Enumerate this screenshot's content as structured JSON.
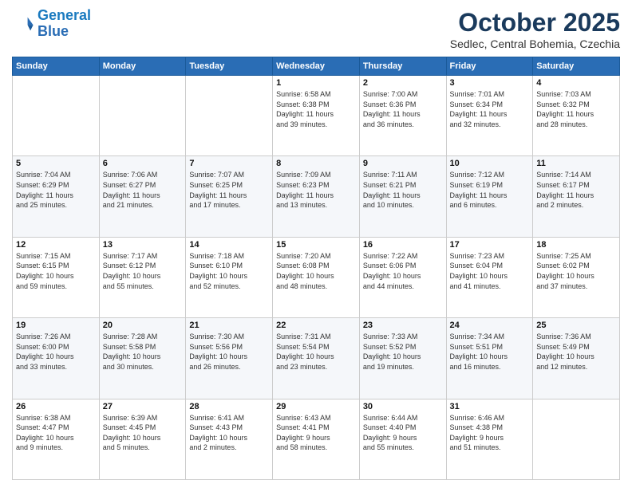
{
  "logo": {
    "line1": "General",
    "line2": "Blue"
  },
  "header": {
    "month": "October 2025",
    "location": "Sedlec, Central Bohemia, Czechia"
  },
  "days_of_week": [
    "Sunday",
    "Monday",
    "Tuesday",
    "Wednesday",
    "Thursday",
    "Friday",
    "Saturday"
  ],
  "weeks": [
    [
      {
        "day": "",
        "info": ""
      },
      {
        "day": "",
        "info": ""
      },
      {
        "day": "",
        "info": ""
      },
      {
        "day": "1",
        "info": "Sunrise: 6:58 AM\nSunset: 6:38 PM\nDaylight: 11 hours\nand 39 minutes."
      },
      {
        "day": "2",
        "info": "Sunrise: 7:00 AM\nSunset: 6:36 PM\nDaylight: 11 hours\nand 36 minutes."
      },
      {
        "day": "3",
        "info": "Sunrise: 7:01 AM\nSunset: 6:34 PM\nDaylight: 11 hours\nand 32 minutes."
      },
      {
        "day": "4",
        "info": "Sunrise: 7:03 AM\nSunset: 6:32 PM\nDaylight: 11 hours\nand 28 minutes."
      }
    ],
    [
      {
        "day": "5",
        "info": "Sunrise: 7:04 AM\nSunset: 6:29 PM\nDaylight: 11 hours\nand 25 minutes."
      },
      {
        "day": "6",
        "info": "Sunrise: 7:06 AM\nSunset: 6:27 PM\nDaylight: 11 hours\nand 21 minutes."
      },
      {
        "day": "7",
        "info": "Sunrise: 7:07 AM\nSunset: 6:25 PM\nDaylight: 11 hours\nand 17 minutes."
      },
      {
        "day": "8",
        "info": "Sunrise: 7:09 AM\nSunset: 6:23 PM\nDaylight: 11 hours\nand 13 minutes."
      },
      {
        "day": "9",
        "info": "Sunrise: 7:11 AM\nSunset: 6:21 PM\nDaylight: 11 hours\nand 10 minutes."
      },
      {
        "day": "10",
        "info": "Sunrise: 7:12 AM\nSunset: 6:19 PM\nDaylight: 11 hours\nand 6 minutes."
      },
      {
        "day": "11",
        "info": "Sunrise: 7:14 AM\nSunset: 6:17 PM\nDaylight: 11 hours\nand 2 minutes."
      }
    ],
    [
      {
        "day": "12",
        "info": "Sunrise: 7:15 AM\nSunset: 6:15 PM\nDaylight: 10 hours\nand 59 minutes."
      },
      {
        "day": "13",
        "info": "Sunrise: 7:17 AM\nSunset: 6:12 PM\nDaylight: 10 hours\nand 55 minutes."
      },
      {
        "day": "14",
        "info": "Sunrise: 7:18 AM\nSunset: 6:10 PM\nDaylight: 10 hours\nand 52 minutes."
      },
      {
        "day": "15",
        "info": "Sunrise: 7:20 AM\nSunset: 6:08 PM\nDaylight: 10 hours\nand 48 minutes."
      },
      {
        "day": "16",
        "info": "Sunrise: 7:22 AM\nSunset: 6:06 PM\nDaylight: 10 hours\nand 44 minutes."
      },
      {
        "day": "17",
        "info": "Sunrise: 7:23 AM\nSunset: 6:04 PM\nDaylight: 10 hours\nand 41 minutes."
      },
      {
        "day": "18",
        "info": "Sunrise: 7:25 AM\nSunset: 6:02 PM\nDaylight: 10 hours\nand 37 minutes."
      }
    ],
    [
      {
        "day": "19",
        "info": "Sunrise: 7:26 AM\nSunset: 6:00 PM\nDaylight: 10 hours\nand 33 minutes."
      },
      {
        "day": "20",
        "info": "Sunrise: 7:28 AM\nSunset: 5:58 PM\nDaylight: 10 hours\nand 30 minutes."
      },
      {
        "day": "21",
        "info": "Sunrise: 7:30 AM\nSunset: 5:56 PM\nDaylight: 10 hours\nand 26 minutes."
      },
      {
        "day": "22",
        "info": "Sunrise: 7:31 AM\nSunset: 5:54 PM\nDaylight: 10 hours\nand 23 minutes."
      },
      {
        "day": "23",
        "info": "Sunrise: 7:33 AM\nSunset: 5:52 PM\nDaylight: 10 hours\nand 19 minutes."
      },
      {
        "day": "24",
        "info": "Sunrise: 7:34 AM\nSunset: 5:51 PM\nDaylight: 10 hours\nand 16 minutes."
      },
      {
        "day": "25",
        "info": "Sunrise: 7:36 AM\nSunset: 5:49 PM\nDaylight: 10 hours\nand 12 minutes."
      }
    ],
    [
      {
        "day": "26",
        "info": "Sunrise: 6:38 AM\nSunset: 4:47 PM\nDaylight: 10 hours\nand 9 minutes."
      },
      {
        "day": "27",
        "info": "Sunrise: 6:39 AM\nSunset: 4:45 PM\nDaylight: 10 hours\nand 5 minutes."
      },
      {
        "day": "28",
        "info": "Sunrise: 6:41 AM\nSunset: 4:43 PM\nDaylight: 10 hours\nand 2 minutes."
      },
      {
        "day": "29",
        "info": "Sunrise: 6:43 AM\nSunset: 4:41 PM\nDaylight: 9 hours\nand 58 minutes."
      },
      {
        "day": "30",
        "info": "Sunrise: 6:44 AM\nSunset: 4:40 PM\nDaylight: 9 hours\nand 55 minutes."
      },
      {
        "day": "31",
        "info": "Sunrise: 6:46 AM\nSunset: 4:38 PM\nDaylight: 9 hours\nand 51 minutes."
      },
      {
        "day": "",
        "info": ""
      }
    ]
  ]
}
